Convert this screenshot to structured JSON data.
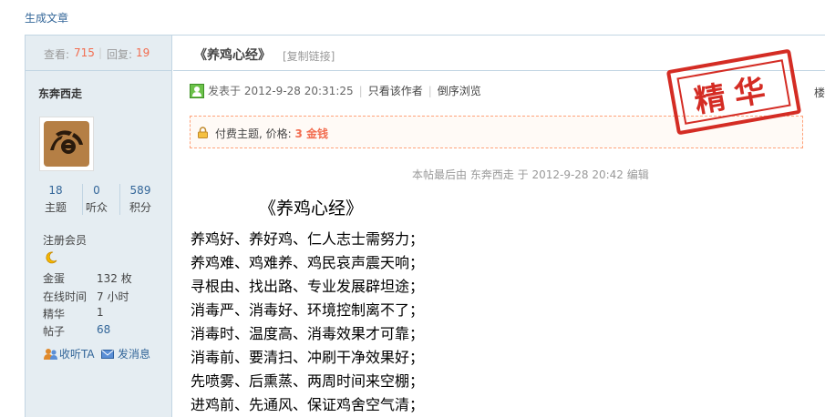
{
  "toolbar": {
    "new_post_label": "生成文章"
  },
  "stats": {
    "views_label": "查看:",
    "views": "715",
    "replies_label": "回复:",
    "replies": "19"
  },
  "author": {
    "name": "东奔西走",
    "counts": [
      {
        "value": "18",
        "label": "主题"
      },
      {
        "value": "0",
        "label": "听众"
      },
      {
        "value": "589",
        "label": "积分"
      }
    ],
    "group": "注册会员",
    "profile": [
      {
        "key": "金蛋",
        "value": "132 枚"
      },
      {
        "key": "在线时间",
        "value": "7 小时"
      },
      {
        "key": "精华",
        "value": "1"
      },
      {
        "key": "帖子",
        "value": "68"
      }
    ],
    "follow_label": "收听TA",
    "message_label": "发消息"
  },
  "post": {
    "title": "《养鸡心经》",
    "copy_link_label": "[复制链接]",
    "posted_label": "发表于 2012-9-28 20:31:25",
    "only_author_label": "只看该作者",
    "reverse_label": "倒序浏览",
    "floor_label": "楼",
    "paid_label": "付费主题, 价格:",
    "paid_price": "3 金钱",
    "stamp_text": "精华",
    "edited_text": "本帖最后由 东奔西走 于 2012-9-28 20:42 编辑",
    "content_title": "《养鸡心经》",
    "lines": [
      "养鸡好、养好鸡、仁人志士需努力；",
      "养鸡难、鸡难养、鸡民哀声震天响；",
      "寻根由、找出路、专业发展辟坦途；",
      "消毒严、消毒好、环境控制离不了；",
      "消毒时、温度高、消毒效果才可靠；",
      "消毒前、要清扫、冲刷干净效果好；",
      "先喷雾、后熏蒸、两周时间来空棚；",
      "进鸡前、先通风、保证鸡舍空气清；"
    ]
  },
  "colors": {
    "accent": "#336699",
    "sidebar_bg": "#e5edf2",
    "border": "#c2d5e3",
    "highlight": "#f26c4f",
    "stamp": "#d42c24"
  }
}
